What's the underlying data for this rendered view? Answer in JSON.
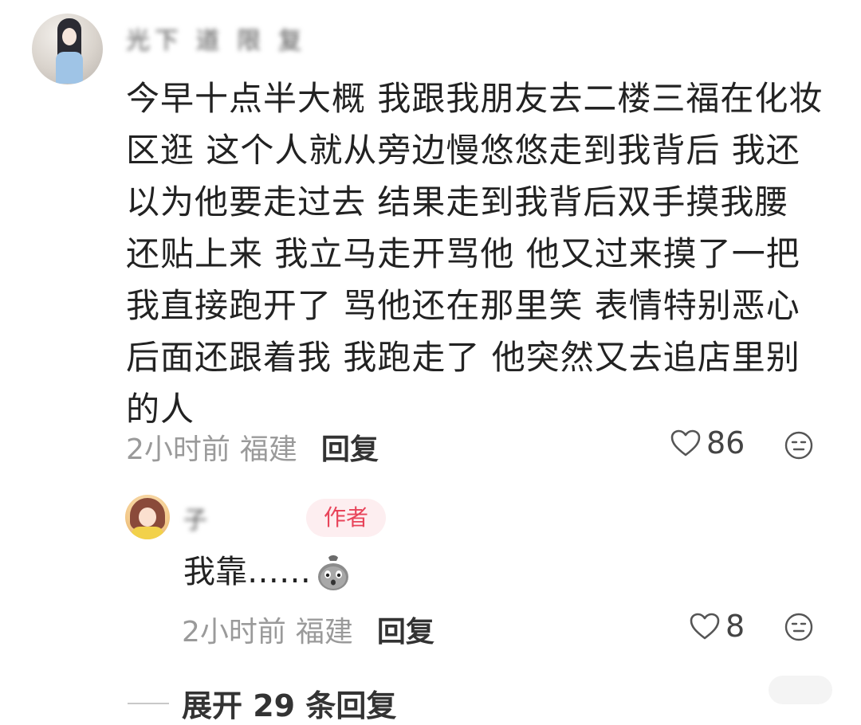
{
  "main_comment": {
    "username": "光下 道 限 复",
    "text": "今早十点半大概 我跟我朋友去二楼三福在化妆区逛 这个人就从旁边慢悠悠走到我背后 我还以为他要走过去 结果走到我背后双手摸我腰 还贴上来 我立马走开骂他 他又过来摸了一把 我直接跑开了 骂他还在那里笑 表情特别恶心 后面还跟着我 我跑走了 他突然又去追店里别的人",
    "time": "2小时前",
    "region": "福建",
    "reply_label": "回复",
    "likes": "86"
  },
  "author_reply": {
    "username": "子",
    "badge": "作者",
    "text": "我靠……",
    "emoji": "surprised-bag-emoji",
    "time": "2小时前",
    "region": "福建",
    "reply_label": "回复",
    "likes": "8"
  },
  "expand_replies": {
    "label": "展开 29 条回复"
  },
  "icons": {
    "like": "heart-outline-icon",
    "react": "face-icon"
  },
  "colors": {
    "badge_text": "#e8445a",
    "badge_bg": "#fdeef0",
    "meta_gray": "#9a9a9a"
  }
}
